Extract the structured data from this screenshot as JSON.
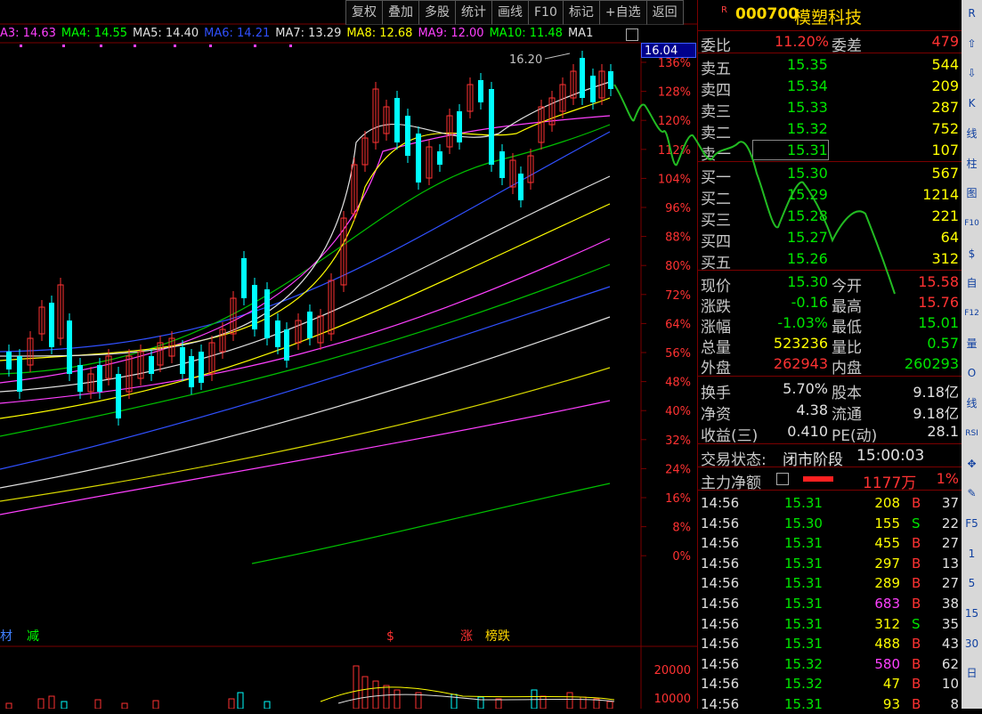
{
  "toolbar": {
    "buttons": [
      "复权",
      "叠加",
      "多股",
      "统计",
      "画线",
      "F10",
      "标记",
      "+自选",
      "返回"
    ]
  },
  "ma_legend": [
    {
      "text": "A3: 14.63",
      "color": "#ff40ff"
    },
    {
      "text": "MA4: 14.55",
      "color": "#00ff00"
    },
    {
      "text": "MA5: 14.40",
      "color": "#e0e0e0"
    },
    {
      "text": "MA6: 14.21",
      "color": "#3050ff"
    },
    {
      "text": "MA7: 13.29",
      "color": "#e0e0e0"
    },
    {
      "text": "MA8: 12.68",
      "color": "#ffff00"
    },
    {
      "text": "MA9: 12.00",
      "color": "#ff40ff"
    },
    {
      "text": "MA10: 11.48",
      "color": "#00ff00"
    },
    {
      "text": "MA1",
      "color": "#e0e0e0"
    }
  ],
  "chart": {
    "price_marker": "16.04",
    "high_label": "16.20",
    "pct_axis": [
      "136%",
      "128%",
      "120%",
      "112%",
      "104%",
      "96%",
      "88%",
      "80%",
      "72%",
      "64%",
      "56%",
      "48%",
      "40%",
      "32%",
      "24%",
      "16%",
      "8%",
      "0%"
    ],
    "volume_axis": [
      "20000",
      "10000"
    ],
    "markers": [
      {
        "text": "材",
        "color": "#4080ff"
      },
      {
        "text": "减",
        "color": "#00ff00"
      },
      {
        "text": "$",
        "color": "#ff3232"
      },
      {
        "text": "涨",
        "color": "#ff3232"
      },
      {
        "text": "榜跌",
        "color": "#ffd700"
      }
    ]
  },
  "stock": {
    "flag": "R",
    "code": "000700",
    "name": "模塑科技"
  },
  "weibi": {
    "label1": "委比",
    "value1": "11.20%",
    "label2": "委差",
    "value2": "479"
  },
  "asks": [
    {
      "label": "卖五",
      "price": "15.35",
      "vol": "544"
    },
    {
      "label": "卖四",
      "price": "15.34",
      "vol": "209"
    },
    {
      "label": "卖三",
      "price": "15.33",
      "vol": "287"
    },
    {
      "label": "卖二",
      "price": "15.32",
      "vol": "752"
    },
    {
      "label": "卖一",
      "price": "15.31",
      "vol": "107"
    }
  ],
  "bids": [
    {
      "label": "买一",
      "price": "15.30",
      "vol": "567"
    },
    {
      "label": "买二",
      "price": "15.29",
      "vol": "1214"
    },
    {
      "label": "买三",
      "price": "15.28",
      "vol": "221"
    },
    {
      "label": "买四",
      "price": "15.27",
      "vol": "64"
    },
    {
      "label": "买五",
      "price": "15.26",
      "vol": "312"
    }
  ],
  "quote": [
    {
      "l1": "现价",
      "v1": "15.30",
      "c1": "green",
      "l2": "今开",
      "v2": "15.58",
      "c2": "red"
    },
    {
      "l1": "涨跌",
      "v1": "-0.16",
      "c1": "green",
      "l2": "最高",
      "v2": "15.76",
      "c2": "red"
    },
    {
      "l1": "涨幅",
      "v1": "-1.03%",
      "c1": "green",
      "l2": "最低",
      "v2": "15.01",
      "c2": "green"
    },
    {
      "l1": "总量",
      "v1": "523236",
      "c1": "yellow",
      "l2": "量比",
      "v2": "0.57",
      "c2": "green"
    },
    {
      "l1": "外盘",
      "v1": "262943",
      "c1": "red",
      "l2": "内盘",
      "v2": "260293",
      "c2": "green"
    }
  ],
  "stats": [
    {
      "l1": "换手",
      "v1": "5.70%",
      "l2": "股本",
      "v2": "9.18亿"
    },
    {
      "l1": "净资",
      "v1": "4.38",
      "l2": "流通",
      "v2": "9.18亿"
    },
    {
      "l1": "收益(三)",
      "v1": "0.410",
      "l2": "PE(动)",
      "v2": "28.1"
    }
  ],
  "status": {
    "label": "交易状态:",
    "value": "闭市阶段",
    "time": "15:00:03"
  },
  "netflow": {
    "label": "主力净额",
    "value": "1177万",
    "pct": "1%"
  },
  "trades": [
    {
      "time": "14:56",
      "price": "15.31",
      "vol": "208",
      "vc": "yellow",
      "side": "B",
      "n": "37"
    },
    {
      "time": "14:56",
      "price": "15.30",
      "vol": "155",
      "vc": "yellow",
      "side": "S",
      "n": "22"
    },
    {
      "time": "14:56",
      "price": "15.31",
      "vol": "455",
      "vc": "yellow",
      "side": "B",
      "n": "27"
    },
    {
      "time": "14:56",
      "price": "15.31",
      "vol": "297",
      "vc": "yellow",
      "side": "B",
      "n": "13"
    },
    {
      "time": "14:56",
      "price": "15.31",
      "vol": "289",
      "vc": "yellow",
      "side": "B",
      "n": "27"
    },
    {
      "time": "14:56",
      "price": "15.31",
      "vol": "683",
      "vc": "magenta",
      "side": "B",
      "n": "38"
    },
    {
      "time": "14:56",
      "price": "15.31",
      "vol": "312",
      "vc": "yellow",
      "side": "S",
      "n": "35"
    },
    {
      "time": "14:56",
      "price": "15.31",
      "vol": "488",
      "vc": "yellow",
      "side": "B",
      "n": "43"
    },
    {
      "time": "14:56",
      "price": "15.32",
      "vol": "580",
      "vc": "magenta",
      "side": "B",
      "n": "62"
    },
    {
      "time": "14:56",
      "price": "15.32",
      "vol": "47",
      "vc": "yellow",
      "side": "B",
      "n": "10"
    },
    {
      "time": "14:56",
      "price": "15.31",
      "vol": "93",
      "vc": "yellow",
      "side": "B",
      "n": "8"
    }
  ],
  "side_icons": [
    "R",
    "⇧",
    "⇩",
    "K",
    "线",
    "柱",
    "图",
    "F10",
    "$",
    "自",
    "F12",
    "量",
    "O",
    "线",
    "RSI",
    "✥",
    "✎",
    "F5",
    "1",
    "5",
    "15",
    "30",
    "日"
  ]
}
